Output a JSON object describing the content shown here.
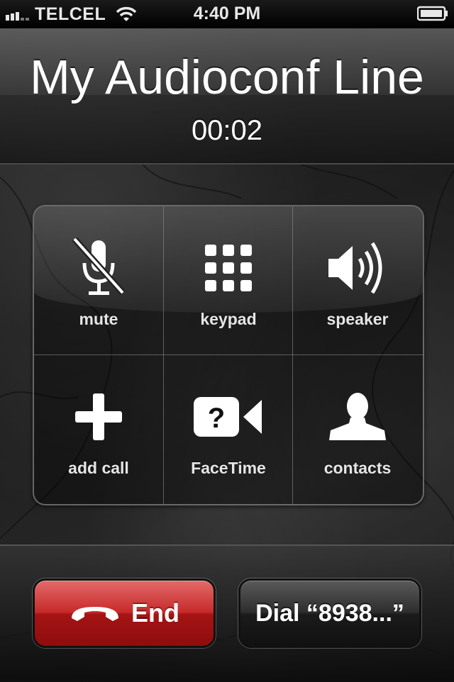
{
  "status_bar": {
    "carrier": "TELCEL",
    "time": "4:40 PM",
    "signal_icon": "signal-bars-icon",
    "wifi_icon": "wifi-icon",
    "battery_icon": "battery-icon"
  },
  "call": {
    "title": "My Audioconf Line",
    "duration": "00:02"
  },
  "controls": [
    {
      "label": "mute",
      "icon": "mute-microphone-icon"
    },
    {
      "label": "keypad",
      "icon": "keypad-grid-icon"
    },
    {
      "label": "speaker",
      "icon": "speaker-icon"
    },
    {
      "label": "add call",
      "icon": "plus-icon"
    },
    {
      "label": "FaceTime",
      "icon": "facetime-camera-icon"
    },
    {
      "label": "contacts",
      "icon": "person-silhouette-icon"
    }
  ],
  "actions": {
    "end_label": "End",
    "dial_label": "Dial “8938...”"
  },
  "colors": {
    "end_button": "#c72b2b",
    "text": "#ffffff"
  }
}
